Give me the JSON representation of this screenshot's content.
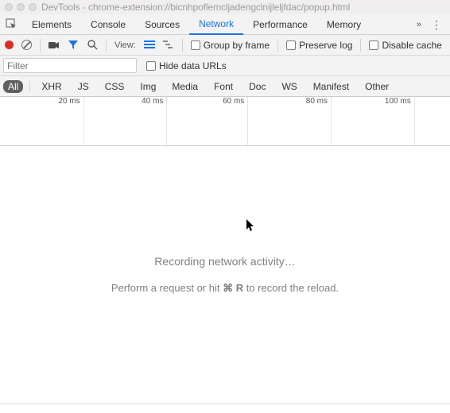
{
  "window": {
    "title": "DevTools - chrome-extension://bicnhpoflemcljadengclnijleljfdac/popup.html"
  },
  "tabs": {
    "elements": "Elements",
    "console": "Console",
    "sources": "Sources",
    "network": "Network",
    "performance": "Performance",
    "memory": "Memory"
  },
  "toolbar": {
    "view_label": "View:",
    "group_by_frame": "Group by frame",
    "preserve_log": "Preserve log",
    "disable_cache": "Disable cache"
  },
  "filter": {
    "placeholder": "Filter",
    "hide_data_urls": "Hide data URLs"
  },
  "types": {
    "all": "All",
    "xhr": "XHR",
    "js": "JS",
    "css": "CSS",
    "img": "Img",
    "media": "Media",
    "font": "Font",
    "doc": "Doc",
    "ws": "WS",
    "manifest": "Manifest",
    "other": "Other"
  },
  "timeline": {
    "t20": "20 ms",
    "t40": "40 ms",
    "t60": "60 ms",
    "t80": "80 ms",
    "t100": "100 ms"
  },
  "empty": {
    "line1": "Recording network activity…",
    "line2_pre": "Perform a request or hit ",
    "line2_key": "⌘ R",
    "line2_post": " to record the reload."
  }
}
